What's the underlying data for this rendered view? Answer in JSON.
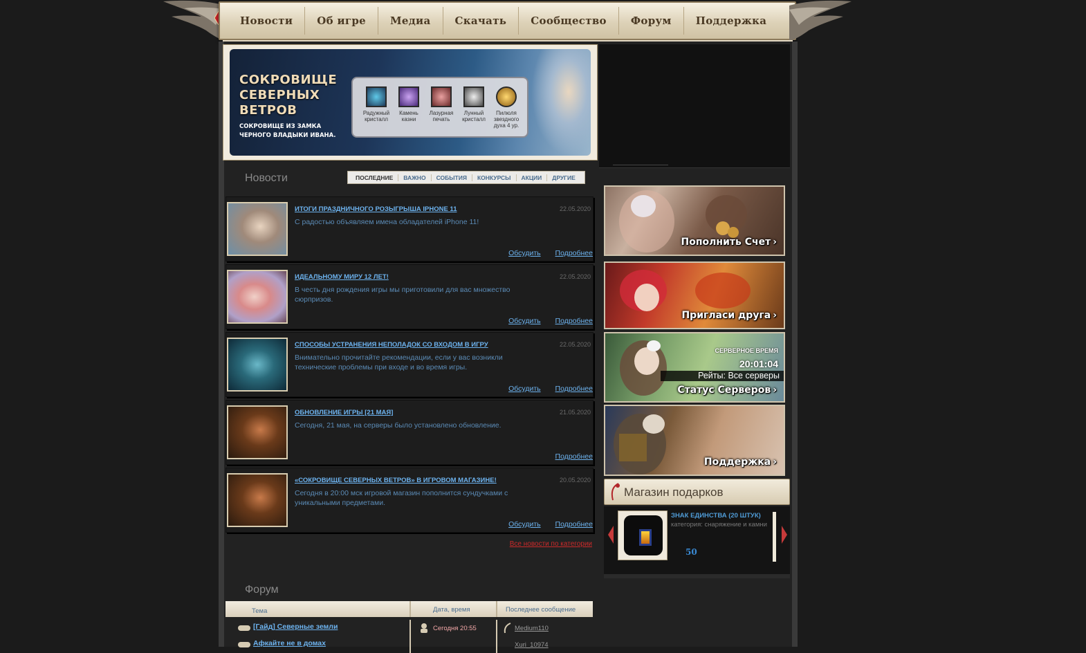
{
  "nav": {
    "items": [
      "Новости",
      "Об игре",
      "Медиа",
      "Скачать",
      "Сообщество",
      "Форум",
      "Поддержка"
    ]
  },
  "banner": {
    "title": "СОКРОВИЩЕ СЕВЕРНЫХ ВЕТРОВ",
    "subtitle": "СОКРОВИЩЕ ИЗ ЗАМКА ЧЕРНОГО ВЛАДЫКИ ИВАНА.",
    "items": [
      {
        "label": "Радужный кристалл",
        "color": "#5fc9e8"
      },
      {
        "label": "Камень казни",
        "color": "#a86be0"
      },
      {
        "label": "Лазурная печать",
        "color": "#c46a6a"
      },
      {
        "label": "Лунный кристалл",
        "color": "#c9c9c9"
      },
      {
        "label": "Пилюля звездного духа 4 ур.",
        "color": "#e0a830"
      }
    ]
  },
  "news": {
    "title": "Новости",
    "tabs": [
      "ПОСЛЕДНИЕ",
      "ВАЖНО",
      "СОБЫТИЯ",
      "КОНКУРСЫ",
      "АКЦИИ",
      "ДРУГИЕ"
    ],
    "items": [
      {
        "title": "ИТОГИ ПРАЗДНИЧНОГО РОЗЫГРЫША IPHONE 11",
        "date": "22.05.2020",
        "text": "С радостью объявляем имена обладателей iPhone 11!",
        "discuss": "Обсудить",
        "more": "Подробнее"
      },
      {
        "title": "ИДЕАЛЬНОМУ МИРУ 12 ЛЕТ!",
        "date": "22.05.2020",
        "text": "В честь дня рождения игры мы приготовили для вас множество сюрпризов.",
        "discuss": "Обсудить",
        "more": "Подробнее"
      },
      {
        "title": "СПОСОБЫ УСТРАНЕНИЯ НЕПОЛАДОК СО ВХОДОМ В ИГРУ",
        "date": "22.05.2020",
        "text": "Внимательно прочитайте рекомендации, если у вас возникли технические проблемы при входе и во время игры.",
        "discuss": "Обсудить",
        "more": "Подробнее"
      },
      {
        "title": "ОБНОВЛЕНИЕ ИГРЫ [21 МАЯ]",
        "date": "21.05.2020",
        "text": "Сегодня, 21 мая, на серверы было установлено обновление.",
        "discuss": "",
        "more": "Подробнее"
      },
      {
        "title": "«СОКРОВИЩЕ СЕВЕРНЫХ ВЕТРОВ» В ИГРОВОМ МАГАЗИНЕ!",
        "date": "20.05.2020",
        "text": "Сегодня в 20:00 мск игровой магазин пополнится сундучками с уникальными предметами.",
        "discuss": "Обсудить",
        "more": "Подробнее"
      }
    ],
    "all_link": "Все новости по категории"
  },
  "promos": {
    "topup": "Пополнить Счет",
    "invite": "Пригласи друга",
    "servers": "Статус Серверов",
    "server_time_label": "СЕРВЕРНОЕ ВРЕМЯ",
    "server_time": "20:01:04",
    "rates": "Рейты: Все серверы",
    "support": "Поддержка"
  },
  "shop": {
    "title": "Магазин подарков",
    "item_name": "ЗНАК ЕДИНСТВА (20 ШТУК)",
    "item_category": "категория: снаряжение и камни",
    "item_price": "50"
  },
  "forum": {
    "title": "Форум",
    "columns": {
      "topic": "Тема",
      "date": "Дата, время",
      "last": "Последнее сообщение"
    },
    "rows": [
      {
        "topic": "[Гайд] Северные земли",
        "date": "Сегодня 20:55",
        "user": "Medium110"
      },
      {
        "topic": "Афкайте не в домах",
        "date": "",
        "user": "Xuri_10974"
      }
    ]
  },
  "colors": {
    "link": "#6db3ef",
    "date_text": "#6a6a6a",
    "accent_red": "#cc2a2a"
  }
}
